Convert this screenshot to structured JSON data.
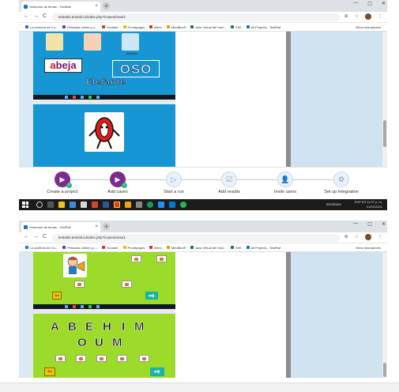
{
  "browser": {
    "tab_title": "Selección de temas - TestRail",
    "tab_close": "×",
    "new_tab": "+",
    "window_controls": [
      "—",
      "▢",
      "✕"
    ],
    "url": "testrails.testrail.io/index.php?/cases/view/1",
    "nav": {
      "back": "←",
      "forward": "→",
      "reload": "C"
    },
    "bookmarks": [
      {
        "label": "La profecía de Cu...",
        "color": "#1a73e8"
      },
      {
        "label": "Películas online y p...",
        "color": "#7b2ab5"
      },
      {
        "label": "Youtube",
        "color": "#e52d27"
      },
      {
        "label": "Promtpages",
        "color": "#f4b400"
      },
      {
        "label": "elibro",
        "color": "#d93025"
      },
      {
        "label": "MindBox®",
        "color": "#f29900"
      },
      {
        "label": "Aula Virtual del Insti...",
        "color": "#0b8043"
      },
      {
        "label": "SIIS",
        "color": "#188038"
      },
      {
        "label": "All Projects - TestRail",
        "color": "#1e73be"
      }
    ],
    "other_bookmarks": "Otros marcadores"
  },
  "slide_top": {
    "word_abeja": "abeja",
    "word_oso": "OSO",
    "word_elefante": "Elefante",
    "label_small": "Elefante"
  },
  "stepper": {
    "steps": [
      {
        "label": "Create a project",
        "state": "active",
        "icon": "project-icon"
      },
      {
        "label": "Add cases",
        "state": "active",
        "icon": "cases-icon"
      },
      {
        "label": "Start a run",
        "state": "inactive",
        "icon": "run-icon"
      },
      {
        "label": "Add results",
        "state": "inactive",
        "icon": "results-icon"
      },
      {
        "label": "Invite users",
        "state": "inactive",
        "icon": "users-icon"
      },
      {
        "label": "Set up Integration",
        "state": "inactive",
        "icon": "integration-icon"
      }
    ]
  },
  "taskbar": {
    "tray_lang": "Escritorio",
    "tray_locale": "ESP ES",
    "time": "11:27 p. m.",
    "date": "21/01/2021"
  },
  "slide_bottom": {
    "letters_row1": [
      "A",
      "B",
      "E",
      "H",
      "I",
      "M"
    ],
    "letters_row2": [
      "O",
      "U",
      "M"
    ],
    "next_arrow": "⇨",
    "exit_icon": "⇦"
  },
  "colors": {
    "blue_slide": "#1796d4",
    "green_slide": "#9cdb2a",
    "step_active": "#7c2b8f",
    "step_check": "#2bb673"
  }
}
